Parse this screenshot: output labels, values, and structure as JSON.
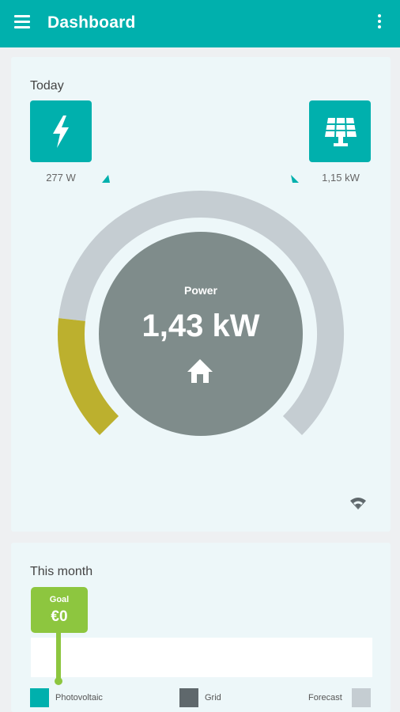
{
  "app_bar": {
    "title": "Dashboard",
    "menu_icon": "hamburger-menu-icon",
    "more_icon": "more-vertical-icon",
    "color": "#00b0ad"
  },
  "today": {
    "title": "Today",
    "grid_tile": {
      "icon": "lightning-bolt-icon",
      "value": "277 W"
    },
    "solar_tile": {
      "icon": "solar-panel-icon",
      "value": "1,15 kW"
    },
    "gauge": {
      "center_label": "Power",
      "center_value": "1,43 kW",
      "center_icon": "home-icon",
      "status_icon": "wifi-signal-icon",
      "grid_fraction": 0.19,
      "colors": {
        "track": "#c5cdd2",
        "grid_segment": "#bcb02e",
        "center": "#7f8c8b",
        "accent": "#00b0ad"
      }
    }
  },
  "month": {
    "title": "This month",
    "goal_label": "Goal",
    "goal_value": "€0",
    "goal_color": "#8dc63f",
    "legend": [
      {
        "label": "Photovoltaic",
        "color": "#00b0ad"
      },
      {
        "label": "Grid",
        "color": "#5f686c"
      },
      {
        "label": "Forecast",
        "color": "#c5cdd2"
      }
    ]
  }
}
